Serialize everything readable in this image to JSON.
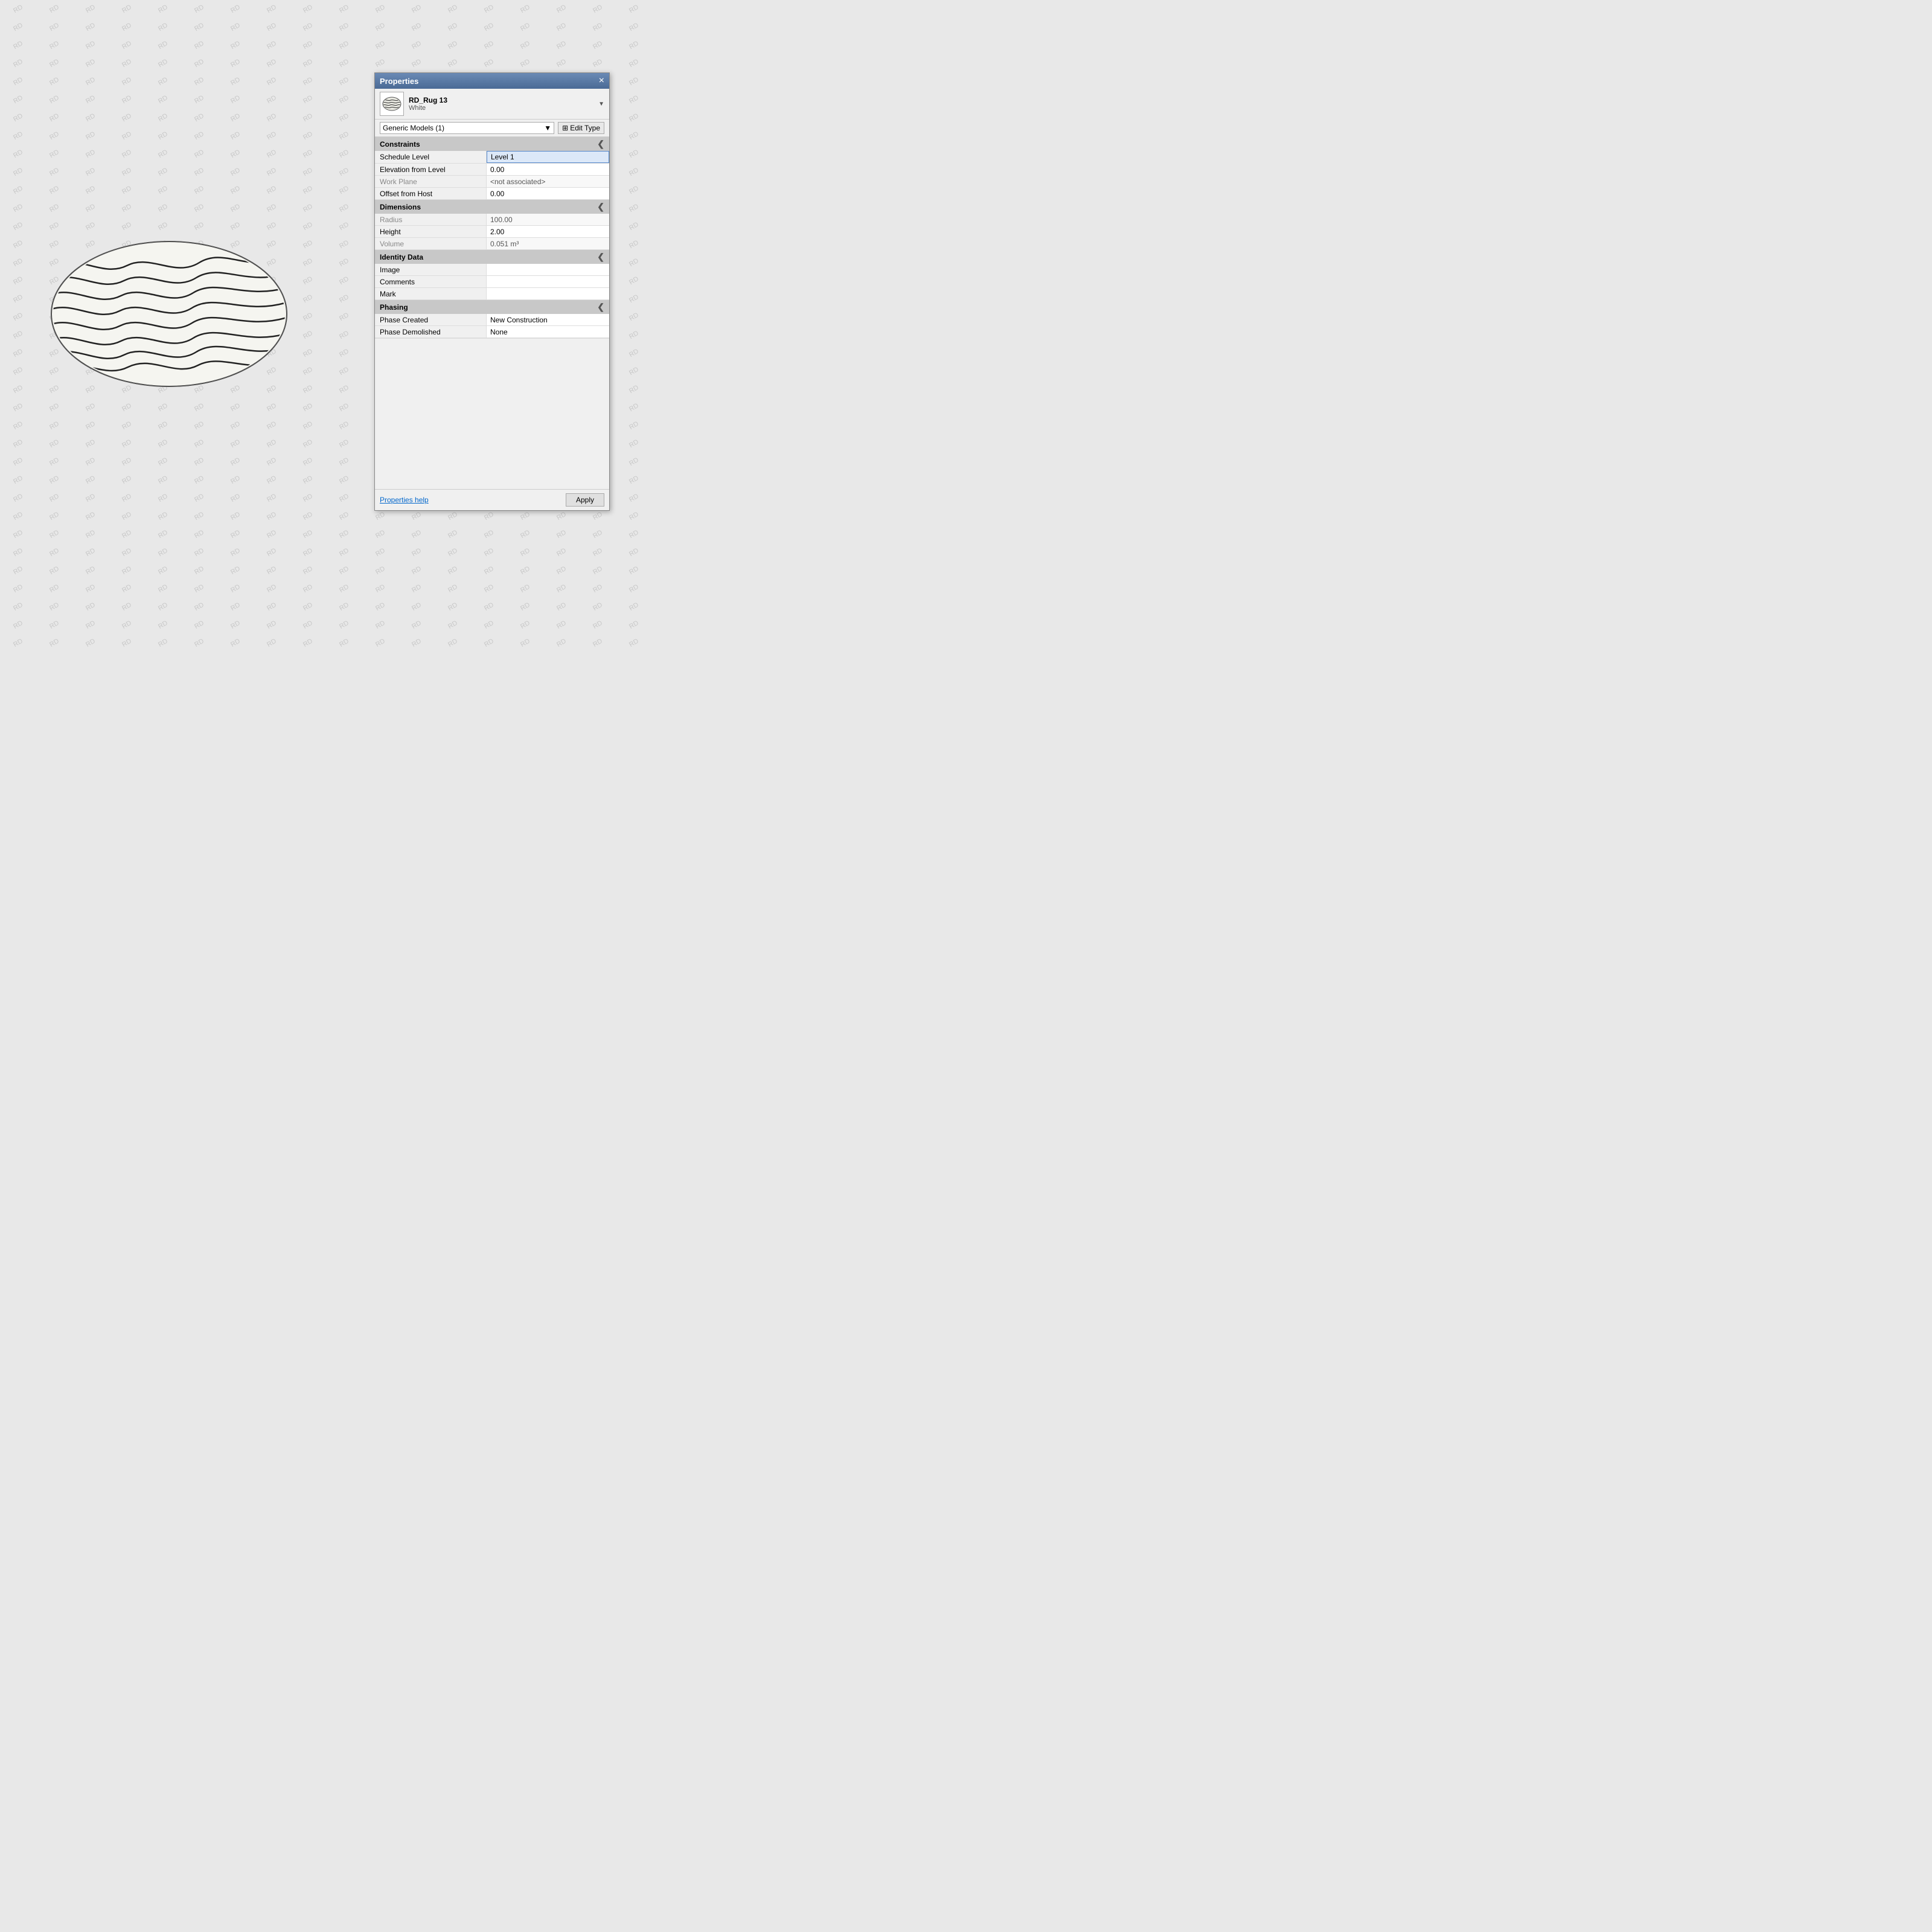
{
  "watermark": {
    "text": "RD"
  },
  "panel": {
    "title": "Properties",
    "close_label": "×",
    "type_name_primary": "RD_Rug 13",
    "type_name_secondary": "White",
    "selector_label": "Generic Models (1)",
    "edit_type_label": "Edit Type",
    "sections": {
      "constraints": {
        "label": "Constraints",
        "collapse_icon": "❮",
        "properties": [
          {
            "label": "Schedule Level",
            "value": "Level 1",
            "active": true,
            "readonly": false
          },
          {
            "label": "Elevation from Level",
            "value": "0.00",
            "active": false,
            "readonly": false
          },
          {
            "label": "Work Plane",
            "value": "<not associated>",
            "active": false,
            "readonly": true
          },
          {
            "label": "Offset from Host",
            "value": "0.00",
            "active": false,
            "readonly": false
          }
        ]
      },
      "dimensions": {
        "label": "Dimensions",
        "collapse_icon": "❮",
        "properties": [
          {
            "label": "Radius",
            "value": "100.00",
            "active": false,
            "readonly": true
          },
          {
            "label": "Height",
            "value": "2.00",
            "active": false,
            "readonly": false
          },
          {
            "label": "Volume",
            "value": "0.051 m³",
            "active": false,
            "readonly": true
          }
        ]
      },
      "identity_data": {
        "label": "Identity Data",
        "collapse_icon": "❮",
        "properties": [
          {
            "label": "Image",
            "value": "",
            "active": false,
            "readonly": false
          },
          {
            "label": "Comments",
            "value": "",
            "active": false,
            "readonly": false
          },
          {
            "label": "Mark",
            "value": "",
            "active": false,
            "readonly": false
          }
        ]
      },
      "phasing": {
        "label": "Phasing",
        "collapse_icon": "❮",
        "properties": [
          {
            "label": "Phase Created",
            "value": "New Construction",
            "active": false,
            "readonly": false
          },
          {
            "label": "Phase Demolished",
            "value": "None",
            "active": false,
            "readonly": false
          }
        ]
      }
    },
    "footer": {
      "help_label": "Properties help",
      "apply_label": "Apply"
    }
  }
}
